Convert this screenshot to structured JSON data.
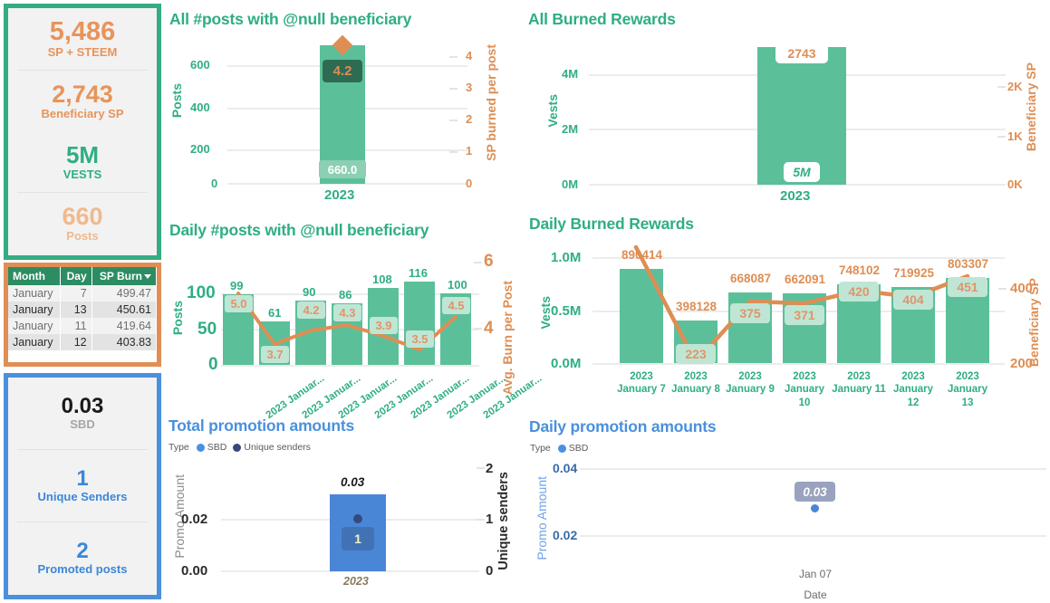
{
  "left_panels": {
    "green_panel": {
      "kpis": [
        {
          "value": "5,486",
          "label": "SP + STEEM"
        },
        {
          "value": "2,743",
          "label": "Beneficiary SP"
        },
        {
          "value": "5M",
          "label": "VESTS"
        },
        {
          "value": "660",
          "label": "Posts"
        }
      ]
    },
    "orange_panel": {
      "table": {
        "columns": [
          "Month",
          "Day",
          "SP Burn"
        ],
        "sorted_column": "SP Burn",
        "rows": [
          [
            "January",
            "7",
            "499.47"
          ],
          [
            "January",
            "13",
            "450.61"
          ],
          [
            "January",
            "11",
            "419.64"
          ],
          [
            "January",
            "12",
            "403.83"
          ]
        ]
      }
    },
    "blue_panel": {
      "kpis": [
        {
          "value": "0.03",
          "label": "SBD"
        },
        {
          "value": "1",
          "label": "Unique Senders"
        },
        {
          "value": "2",
          "label": "Promoted posts"
        }
      ]
    }
  },
  "chart_data": [
    {
      "id": "all_posts_null_beneficiary",
      "type": "bar",
      "title": "All #posts with @null beneficiary",
      "categories": [
        "2023"
      ],
      "series": [
        {
          "name": "Posts",
          "type": "bar",
          "values": [
            660
          ],
          "data_labels": [
            "660.0"
          ]
        },
        {
          "name": "SP burned per post",
          "type": "marker",
          "values": [
            4.2
          ],
          "data_labels": [
            "4.2"
          ]
        }
      ],
      "xlabel": "",
      "ylabel": "Posts",
      "y2label": "SP burned per post",
      "yticks": [
        "0",
        "200",
        "400",
        "600"
      ],
      "ylim": [
        0,
        700
      ],
      "y2ticks": [
        "0",
        "1",
        "2",
        "3",
        "4"
      ],
      "y2lim": [
        0,
        4.35
      ],
      "grid": true
    },
    {
      "id": "all_burned_rewards",
      "type": "bar",
      "title": "All Burned Rewards",
      "categories": [
        "2023"
      ],
      "series": [
        {
          "name": "Vests",
          "type": "bar",
          "values": [
            5000000
          ],
          "data_labels": [
            "5M"
          ]
        },
        {
          "name": "Beneficiary SP",
          "type": "marker",
          "values": [
            2743
          ],
          "data_labels": [
            "2743"
          ]
        }
      ],
      "xlabel": "",
      "ylabel": "Vests",
      "y2label": "Beneficiary SP",
      "yticks": [
        "0M",
        "2M",
        "4M"
      ],
      "ylim": [
        0,
        5400000
      ],
      "y2ticks": [
        "0K",
        "1K",
        "2K"
      ],
      "y2lim": [
        0,
        2900
      ],
      "grid": true
    },
    {
      "id": "daily_posts_null_beneficiary",
      "type": "bar",
      "title": "Daily #posts with @null beneficiary",
      "categories": [
        "2023 Januar...",
        "2023 Januar...",
        "2023 Januar...",
        "2023 Januar...",
        "2023 Januar...",
        "2023 Januar...",
        "2023 Januar..."
      ],
      "series": [
        {
          "name": "Posts",
          "type": "bar",
          "values": [
            99,
            61,
            90,
            86,
            108,
            116,
            100
          ],
          "data_labels": [
            "99",
            "61",
            "90",
            "86",
            "108",
            "116",
            "100"
          ]
        },
        {
          "name": "Avg. Burn per Post",
          "type": "line",
          "values": [
            5.0,
            3.7,
            4.2,
            4.3,
            3.9,
            3.5,
            4.5
          ],
          "data_labels": [
            "5.0",
            "3.7",
            "4.2",
            "4.3",
            "3.9",
            "3.5",
            "4.5"
          ]
        }
      ],
      "xlabel": "",
      "ylabel": "Posts",
      "y2label": "Avg. Burn per Post",
      "yticks": [
        "0",
        "50",
        "100"
      ],
      "ylim": [
        0,
        125
      ],
      "y2ticks": [
        "4",
        "6"
      ],
      "y2lim": [
        3.1,
        6.25
      ],
      "grid": true
    },
    {
      "id": "daily_burned_rewards",
      "type": "bar",
      "title": "Daily Burned Rewards",
      "categories": [
        "2023 January 7",
        "2023 January 8",
        "2023 January 9",
        "2023 January 10",
        "2023 January 11",
        "2023 January 12",
        "2023 January 13"
      ],
      "series": [
        {
          "name": "Vests",
          "type": "bar",
          "values": [
            890414,
            398128,
            668087,
            662091,
            748102,
            719925,
            803307
          ],
          "data_labels": [
            "890414",
            "398128",
            "668087",
            "662091",
            "748102",
            "719925",
            "803307"
          ]
        },
        {
          "name": "Beneficiary SP",
          "type": "line",
          "values": [
            499,
            223,
            375,
            371,
            420,
            404,
            451
          ],
          "data_labels": [
            "",
            "223",
            "375",
            "371",
            "420",
            "404",
            "451"
          ]
        }
      ],
      "xlabel": "",
      "ylabel": "Vests",
      "y2label": "Beneficiary SP",
      "yticks": [
        "0.0M",
        "0.5M",
        "1.0M"
      ],
      "ylim": [
        0,
        1000000
      ],
      "y2ticks": [
        "200",
        "400"
      ],
      "y2lim": [
        200,
        500
      ],
      "grid": true
    },
    {
      "id": "total_promotion_amounts",
      "type": "bar",
      "title": "Total promotion amounts",
      "legend_title": "Type",
      "legend": [
        {
          "label": "SBD",
          "color": "#4A90E2"
        },
        {
          "label": "Unique senders",
          "color": "#35497E"
        }
      ],
      "categories": [
        "2023"
      ],
      "series": [
        {
          "name": "SBD",
          "type": "bar",
          "values": [
            0.03
          ],
          "data_labels": [
            "0.03"
          ]
        },
        {
          "name": "Unique senders",
          "type": "marker",
          "values": [
            1
          ],
          "data_labels": [
            "1"
          ]
        }
      ],
      "xlabel": "",
      "ylabel": "Promo Amount",
      "y2label": "Unique senders",
      "yticks": [
        "0.00",
        "0.02"
      ],
      "ylim": [
        0,
        0.035
      ],
      "y2ticks": [
        "0",
        "1",
        "2"
      ],
      "y2lim": [
        0,
        2
      ],
      "grid": true
    },
    {
      "id": "daily_promotion_amounts",
      "type": "scatter",
      "title": "Daily promotion amounts",
      "legend_title": "Type",
      "legend": [
        {
          "label": "SBD",
          "color": "#4A90E2"
        }
      ],
      "x": [
        "Jan 07"
      ],
      "series": [
        {
          "name": "SBD",
          "type": "scatter",
          "values": [
            0.03
          ],
          "data_labels": [
            "0.03"
          ]
        }
      ],
      "xlabel": "Date",
      "ylabel": "Promo Amount",
      "yticks": [
        "0.02",
        "0.04"
      ],
      "ylim": [
        0.015,
        0.042
      ],
      "xticks": [
        "Jan 07"
      ],
      "grid": true
    }
  ],
  "colors": {
    "green_accent": "#2FAE83",
    "green_bar": "#5BC09A",
    "orange_accent": "#DE8E54",
    "blue_accent": "#4A90DD",
    "blue_bar": "#4A86D6",
    "panel_border_green": "#35AC82",
    "panel_border_orange": "#E08E55",
    "panel_border_blue": "#4A90DD"
  }
}
